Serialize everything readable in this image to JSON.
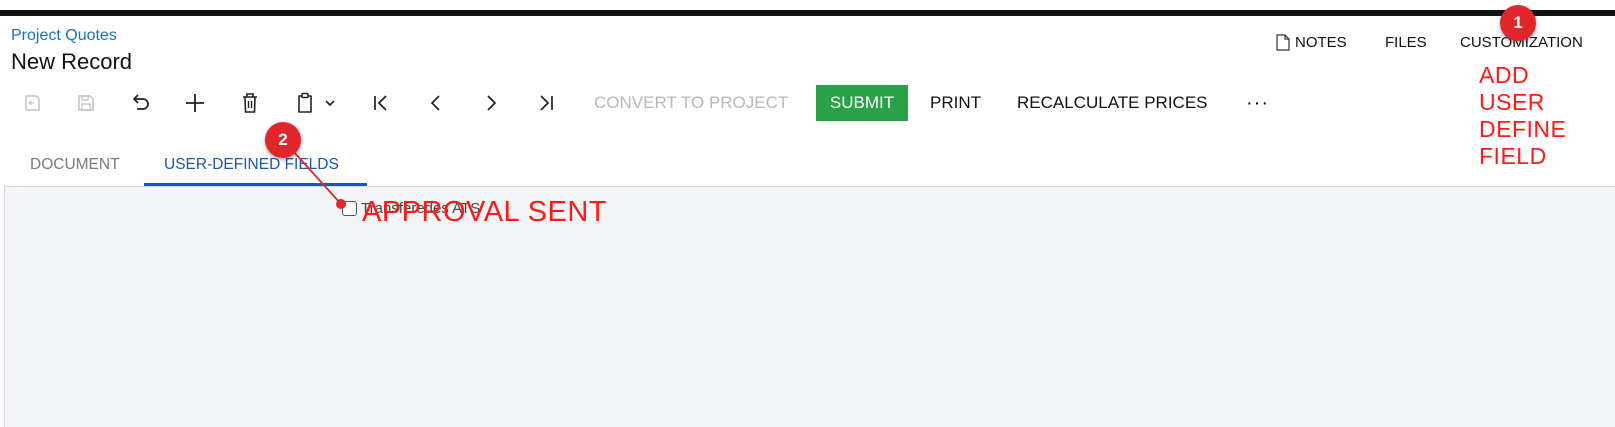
{
  "breadcrumb": "Project Quotes",
  "page_title": "New Record",
  "header_links": {
    "notes": "NOTES",
    "files": "FILES",
    "customization": "CUSTOMIZATION"
  },
  "toolbar": {
    "icons": [
      "cancel-changes-icon",
      "save-icon",
      "undo-icon",
      "add-icon",
      "delete-icon",
      "copy-paste-icon",
      "chevron-down-icon",
      "first-record-icon",
      "previous-record-icon",
      "next-record-icon",
      "last-record-icon"
    ],
    "convert": "CONVERT TO PROJECT",
    "submit": "SUBMIT",
    "print": "PRINT",
    "recalculate": "RECALCULATE PRICES",
    "more": "···"
  },
  "tabs": {
    "document": "DOCUMENT",
    "user_defined": "USER-DEFINED FIELDS",
    "active": "USER-DEFINED FIELDS"
  },
  "fields": {
    "checkbox_label": "Transferedes ATS",
    "checkbox_checked": false
  },
  "annotations": {
    "badge1": "1",
    "badge2": "2",
    "approval_sent": "APPROVAL SENT",
    "add_user_define_field": [
      "ADD",
      "USER",
      "DEFINE",
      "FIELD"
    ],
    "color": "#ff1a1a"
  },
  "colors": {
    "accent": "#1c57b0",
    "submit_bg": "#2aa048",
    "link": "#1a73ba"
  }
}
